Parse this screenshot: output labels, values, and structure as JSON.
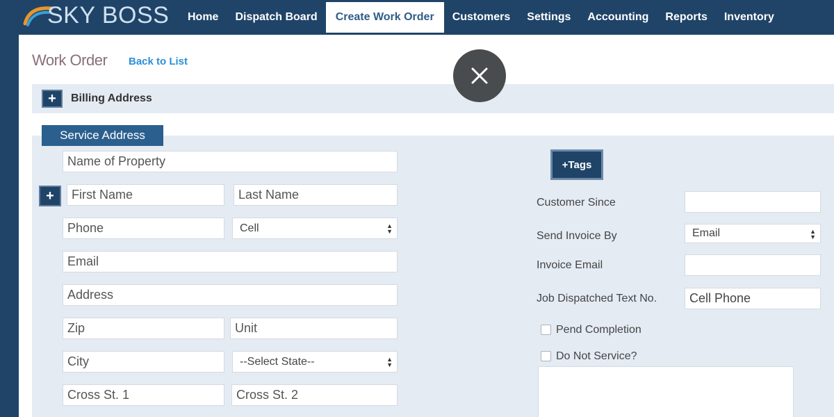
{
  "brand": {
    "name": "SKY BOSS"
  },
  "nav": {
    "items": [
      {
        "label": "Home"
      },
      {
        "label": "Dispatch Board"
      },
      {
        "label": "Create Work Order",
        "active": true
      },
      {
        "label": "Customers"
      },
      {
        "label": "Settings"
      },
      {
        "label": "Accounting"
      },
      {
        "label": "Reports"
      },
      {
        "label": "Inventory"
      }
    ]
  },
  "page": {
    "title": "Work Order",
    "back_link": "Back to List"
  },
  "billing": {
    "label": "Billing Address",
    "toggle": "+"
  },
  "service": {
    "tab_label": "Service Address",
    "add_contact": "+",
    "fields": {
      "property_name": {
        "value": "",
        "placeholder": "Name of Property"
      },
      "first_name": {
        "value": "",
        "placeholder": "First Name"
      },
      "last_name": {
        "value": "",
        "placeholder": "Last Name"
      },
      "phone": {
        "value": "",
        "placeholder": "Phone"
      },
      "phone_type": {
        "selected": "Cell"
      },
      "email": {
        "value": "",
        "placeholder": "Email"
      },
      "address": {
        "value": "",
        "placeholder": "Address"
      },
      "zip": {
        "value": "",
        "placeholder": "Zip"
      },
      "unit": {
        "value": "",
        "placeholder": "Unit"
      },
      "city": {
        "value": "",
        "placeholder": "City"
      },
      "state": {
        "selected": "--Select State--"
      },
      "cross_st_1": {
        "value": "",
        "placeholder": "Cross St. 1"
      },
      "cross_st_2": {
        "value": "",
        "placeholder": "Cross St. 2"
      }
    }
  },
  "side": {
    "tags_button": "+Tags",
    "customer_since": {
      "label": "Customer Since",
      "value": ""
    },
    "send_invoice_by": {
      "label": "Send Invoice By",
      "selected": "Email"
    },
    "invoice_email": {
      "label": "Invoice Email",
      "value": ""
    },
    "job_dispatched": {
      "label": "Job Dispatched Text No.",
      "value": "Cell Phone"
    },
    "pend_completion": {
      "label": "Pend Completion",
      "checked": false
    },
    "do_not_service": {
      "label": "Do Not Service?",
      "checked": false
    }
  },
  "overlay": {
    "close_icon": "close-icon"
  },
  "colors": {
    "nav_bg": "#1f4468",
    "accent_blue": "#2b5f8e",
    "link": "#2c8fd8",
    "panel_bg": "#e5ebf3"
  }
}
